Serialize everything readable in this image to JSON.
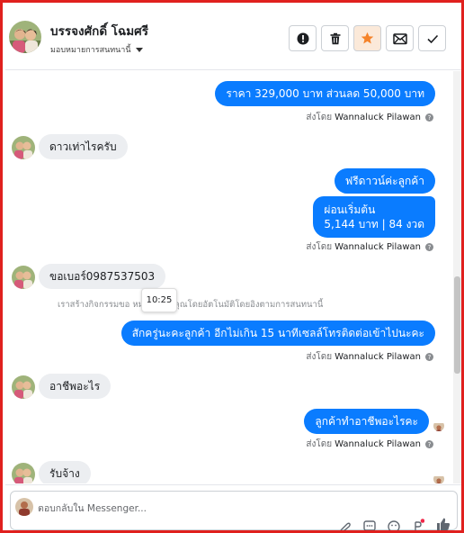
{
  "header": {
    "contact_name": "บรรจงศักดิ์ โฉมศรี",
    "assign_label": "มอบหมายการสนทนานี้",
    "actions": [
      {
        "name": "spam-button",
        "icon": "alert-circle-icon"
      },
      {
        "name": "delete-button",
        "icon": "trash-icon"
      },
      {
        "name": "star-button",
        "icon": "star-icon",
        "color": "#f5832a"
      },
      {
        "name": "mark-unread-button",
        "icon": "envelope-icon"
      },
      {
        "name": "done-button",
        "icon": "checkmark-icon"
      }
    ]
  },
  "messages": {
    "m1": "ราคา 329,000 บาท  ส่วนลด 50,000  บาท",
    "m2": "ดาวเท่าไรครับ",
    "m3": "ฟรีดาวน์ค่ะลูกค้า",
    "m4_line1": "ผ่อนเริ่มต้น",
    "m4_line2": "5,144 บาท | 84 งวด",
    "m5": "ขอเบอร์0987537503",
    "m6": "สักครู่นะคะลูกค้า อีกไม่เกิน  15 นาทีเซลล์โทรติดต่อเข้าไปนะคะ",
    "m7": "อาชีพอะไร",
    "m8": "ลูกค้าทำอาชีพอะไรคะ",
    "m9": "รับจ้าง"
  },
  "sent_by": {
    "prefix": "ส่งโดย",
    "agent": "Wannaluck Pilawan",
    "info_glyph": "?"
  },
  "system_note": "เราสร้างกิจกรรมขอ                หมายให้กับคุณโดยอัตโนมัติโดยอิงตามการสนทนานี้",
  "tooltip_time": "10:25",
  "composer": {
    "placeholder": "ตอบกลับใน Messenger..."
  },
  "colors": {
    "outgoing_bubble": "#0a7cff",
    "incoming_bubble": "#eceef1",
    "frame_border": "#e0201e",
    "star_accent": "#f5832a"
  }
}
